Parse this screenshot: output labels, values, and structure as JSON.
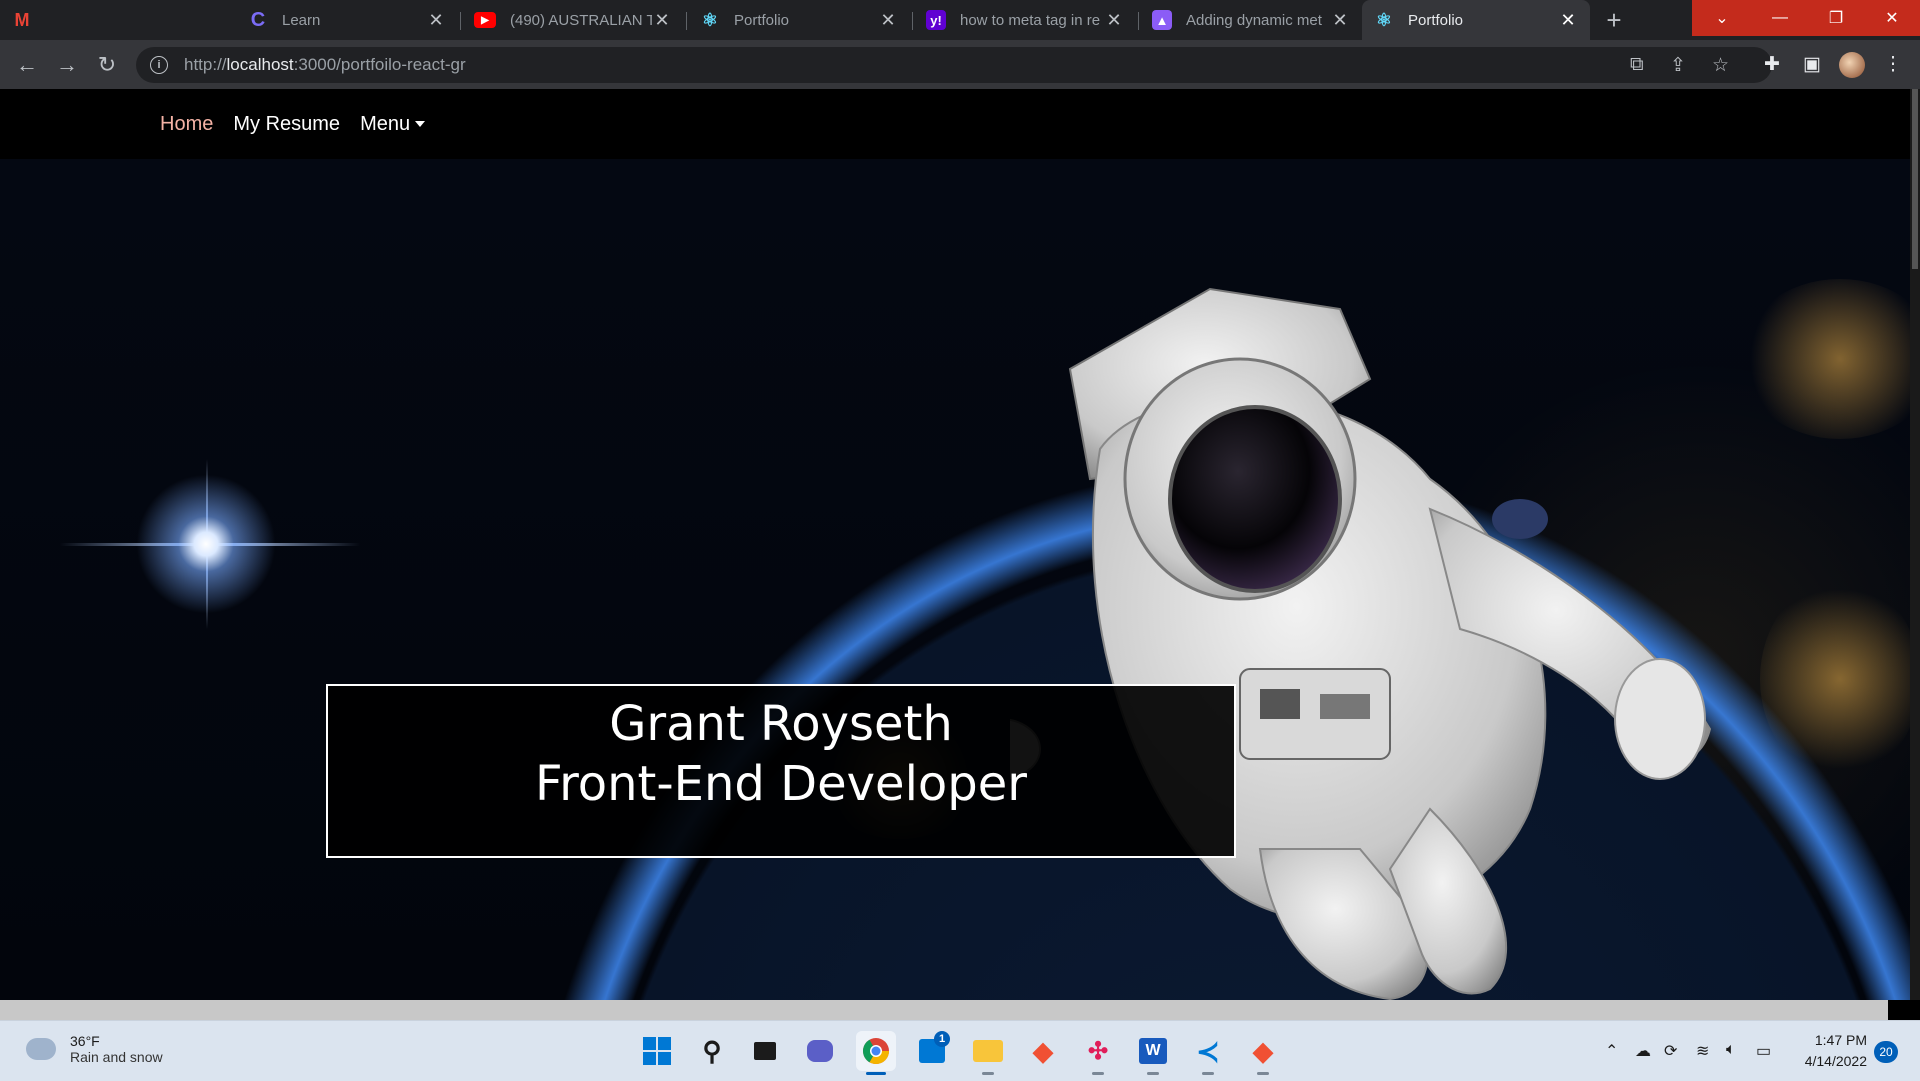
{
  "browser": {
    "tabs": [
      {
        "title": "",
        "icon": "gmail-icon",
        "active": false
      },
      {
        "title": "Learn",
        "icon": "c-logo-icon",
        "active": false
      },
      {
        "title": "(490) AUSTRALIAN T...",
        "icon": "youtube-icon",
        "active": false
      },
      {
        "title": "Portfolio",
        "icon": "react-icon",
        "active": false
      },
      {
        "title": "how to meta tag in re",
        "icon": "yahoo-icon",
        "active": false
      },
      {
        "title": "Adding dynamic met",
        "icon": "rocket-icon",
        "active": false
      },
      {
        "title": "Portfolio",
        "icon": "react-icon",
        "active": true
      }
    ],
    "address": {
      "prefix": "http://",
      "host": "localhost",
      "rest": ":3000/portfoilo-react-gr"
    }
  },
  "site": {
    "nav": {
      "home": "Home",
      "resume": "My Resume",
      "menu": "Menu"
    },
    "hero": {
      "name": "Grant Royseth",
      "role": "Front-End Developer"
    }
  },
  "taskbar": {
    "weather": {
      "temp": "36°F",
      "desc": "Rain and snow"
    },
    "clock": {
      "time": "1:47 PM",
      "date": "4/14/2022"
    },
    "notifications": "20",
    "store_badge": "1"
  },
  "colors": {
    "active_nav": "#f4b2a5",
    "window_controls": "#c42b1c",
    "tab_strip": "#202124"
  }
}
